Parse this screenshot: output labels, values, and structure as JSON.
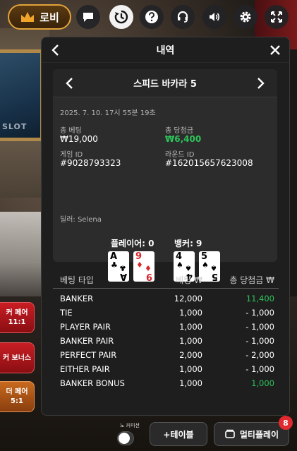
{
  "background": {
    "slot_sign": "SLOT"
  },
  "topbar": {
    "lobby_label": "로비",
    "icons": [
      "chat-icon",
      "history-icon",
      "help-icon",
      "headset-icon",
      "sound-icon",
      "settings-icon",
      "fullscreen-icon"
    ]
  },
  "side_bets": [
    {
      "line1": "커 페어",
      "line2": "11:1"
    },
    {
      "line1": "커 보너스",
      "line2": ""
    },
    {
      "line1": "더 페어",
      "line2": "5:1"
    }
  ],
  "panel": {
    "title": "내역",
    "game_name": "스피드 바카라 5",
    "datetime": "2025. 7. 10. 17시 55분 19초",
    "total_bet_label": "총 베팅",
    "total_bet_value": "₩19,000",
    "total_win_label": "총 당첨금",
    "total_win_value": "₩6,400",
    "game_id_label": "게임 ID",
    "game_id_value": "#9028793323",
    "round_id_label": "라운드 ID",
    "round_id_value": "#162015657623008",
    "dealer": "딜러: Selena",
    "player_label": "플레이어: 0",
    "banker_label": "뱅커: 9",
    "player_cards": [
      {
        "rank": "A",
        "suit": "♣",
        "color": "black"
      },
      {
        "rank": "9",
        "suit": "♦",
        "color": "red"
      }
    ],
    "banker_cards": [
      {
        "rank": "4",
        "suit": "♠",
        "color": "black"
      },
      {
        "rank": "5",
        "suit": "♠",
        "color": "black"
      }
    ],
    "table_headers": {
      "type": "베팅 타입",
      "bet": "베팅 ₩",
      "win": "총 당첨금 ₩"
    },
    "rows": [
      {
        "type": "BANKER",
        "bet": "12,000",
        "win": "11,400",
        "win_color": "green"
      },
      {
        "type": "TIE",
        "bet": "1,000",
        "win": "- 1,000",
        "win_color": "white"
      },
      {
        "type": "PLAYER PAIR",
        "bet": "1,000",
        "win": "- 1,000",
        "win_color": "white"
      },
      {
        "type": "BANKER PAIR",
        "bet": "1,000",
        "win": "- 1,000",
        "win_color": "white"
      },
      {
        "type": "PERFECT PAIR",
        "bet": "2,000",
        "win": "- 2,000",
        "win_color": "white"
      },
      {
        "type": "EITHER PAIR",
        "bet": "1,000",
        "win": "- 1,000",
        "win_color": "white"
      },
      {
        "type": "BANKER BONUS",
        "bet": "1,000",
        "win": "1,000",
        "win_color": "green"
      }
    ]
  },
  "bottom": {
    "toggle_label": "노 커미션",
    "add_table_label": "+테이블",
    "multiplay_label": "멀티플레이",
    "multiplay_badge": "8"
  },
  "colors": {
    "accent_gold": "#e2a33a",
    "win_green": "#2ec25a",
    "badge_red": "#e02a2f"
  }
}
